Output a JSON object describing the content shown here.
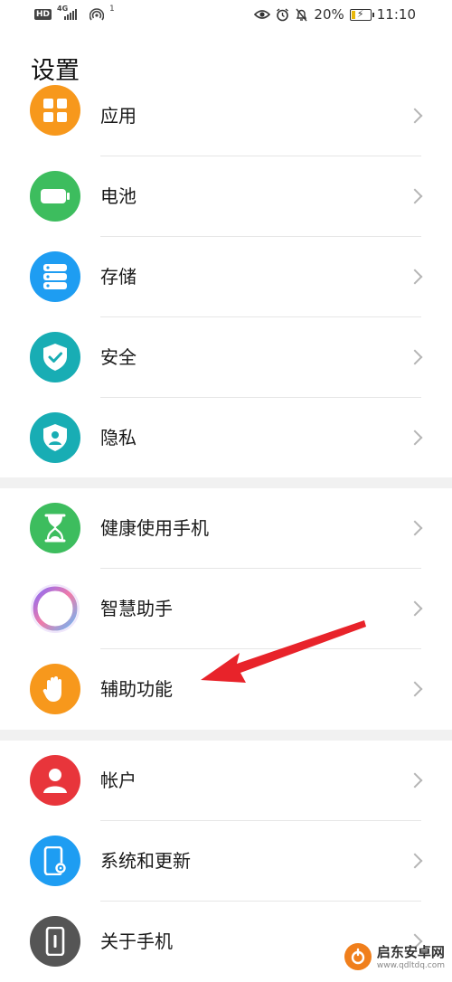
{
  "status_bar": {
    "hd": "HD",
    "network": "4G",
    "hotspot_count": "1",
    "battery_percent": "20%",
    "battery_level": 0.2,
    "time": "11:10"
  },
  "page_title": "设置",
  "menu": [
    {
      "id": "apps",
      "label": "应用",
      "icon": "apps-grid-icon",
      "color": "#F7981C"
    },
    {
      "id": "battery",
      "label": "电池",
      "icon": "battery-icon",
      "color": "#3DBD5E"
    },
    {
      "id": "storage",
      "label": "存储",
      "icon": "storage-icon",
      "color": "#1E9DF2"
    },
    {
      "id": "security",
      "label": "安全",
      "icon": "shield-check-icon",
      "color": "#18ADB4"
    },
    {
      "id": "privacy",
      "label": "隐私",
      "icon": "privacy-shield-icon",
      "color": "#18ADB4"
    },
    {
      "id": "digital-balance",
      "label": "健康使用手机",
      "icon": "hourglass-icon",
      "color": "#3DBD5E"
    },
    {
      "id": "assistant",
      "label": "智慧助手",
      "icon": "assistant-ring-icon",
      "color": "#FFFFFF"
    },
    {
      "id": "accessibility",
      "label": "辅助功能",
      "icon": "hand-icon",
      "color": "#F7981C"
    },
    {
      "id": "account",
      "label": "帐户",
      "icon": "user-icon",
      "color": "#E8353B"
    },
    {
      "id": "system",
      "label": "系统和更新",
      "icon": "phone-settings-icon",
      "color": "#1E9DF2"
    },
    {
      "id": "about",
      "label": "关于手机",
      "icon": "phone-info-icon",
      "color": "#555555"
    }
  ],
  "watermark": {
    "name": "启东安卓网",
    "url": "www.qdltdq.com"
  }
}
